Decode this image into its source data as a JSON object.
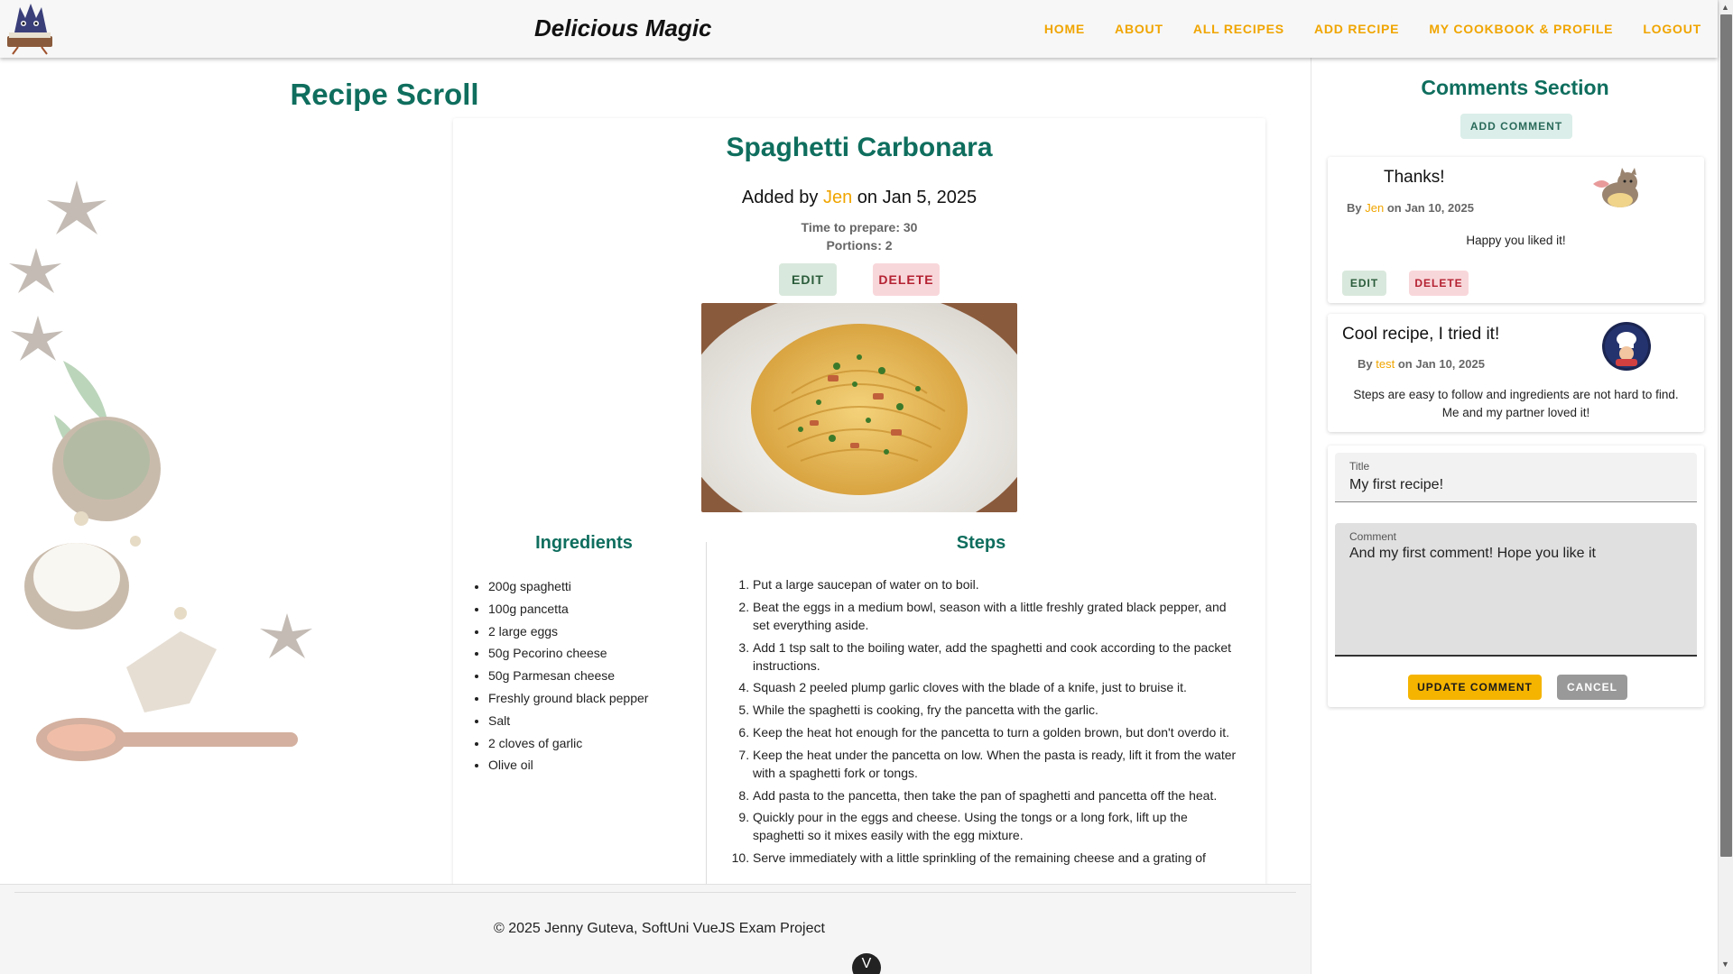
{
  "nav": {
    "brand": "Delicious Magic",
    "links": [
      "HOME",
      "ABOUT",
      "ALL RECIPES",
      "ADD RECIPE",
      "MY COOKBOOK & PROFILE",
      "LOGOUT"
    ]
  },
  "page": {
    "title": "Recipe Scroll"
  },
  "recipe": {
    "title": "Spaghetti Carbonara",
    "added_prefix": "Added by",
    "author": "Jen",
    "date_text": "on Jan 5, 2025",
    "time": "Time to prepare: 30",
    "portions": "Portions: 2",
    "edit_label": "EDIT",
    "delete_label": "DELETE",
    "ingredients_title": "Ingredients",
    "steps_title": "Steps",
    "ingredients": [
      "200g spaghetti",
      "100g pancetta",
      "2 large eggs",
      "50g Pecorino cheese",
      "50g Parmesan cheese",
      "Freshly ground black pepper",
      "Salt",
      "2 cloves of garlic",
      "Olive oil"
    ],
    "steps": [
      "Put a large saucepan of water on to boil.",
      "Beat the eggs in a medium bowl, season with a little freshly grated black pepper, and set everything aside.",
      "Add 1 tsp salt to the boiling water, add the spaghetti and cook according to the packet instructions.",
      "Squash 2 peeled plump garlic cloves with the blade of a knife, just to bruise it.",
      "While the spaghetti is cooking, fry the pancetta with the garlic.",
      "Keep the heat hot enough for the pancetta to turn a golden brown, but don't overdo it.",
      "Keep the heat under the pancetta on low. When the pasta is ready, lift it from the water with a spaghetti fork or tongs.",
      "Add pasta to the pancetta, then take the pan of spaghetti and pancetta off the heat.",
      "Quickly pour in the eggs and cheese. Using the tongs or a long fork, lift up the spaghetti so it mixes easily with the egg mixture.",
      "Serve immediately with a little sprinkling of the remaining cheese and a grating of"
    ]
  },
  "footer": {
    "text": "© 2025 Jenny Guteva, SoftUni VueJS Exam Project",
    "scroll_glyph": "V"
  },
  "comments": {
    "title": "Comments Section",
    "add_label": "ADD COMMENT",
    "items": [
      {
        "title": "Thanks!",
        "by": "By",
        "author": "Jen",
        "date": "on Jan 10, 2025",
        "body": "Happy you liked it!",
        "edit_label": "EDIT",
        "delete_label": "DELETE",
        "avatar": "cat-avatar"
      },
      {
        "title": "Cool recipe, I tried it!",
        "by": "By",
        "author": "test",
        "date": "on Jan 10, 2025",
        "body_line1": "Steps are easy to follow and ingredients are not hard to find.",
        "body_line2": "Me and my partner loved it!",
        "avatar": "chef-avatar"
      }
    ],
    "form": {
      "title_label": "Title",
      "title_value": "My first recipe!",
      "comment_label": "Comment",
      "comment_value": "And my first comment! Hope you like it",
      "update_label": "UPDATE COMMENT",
      "cancel_label": "CANCEL"
    }
  },
  "colors": {
    "accent_teal": "#0f6e5e",
    "accent_orange": "#f0a500"
  }
}
